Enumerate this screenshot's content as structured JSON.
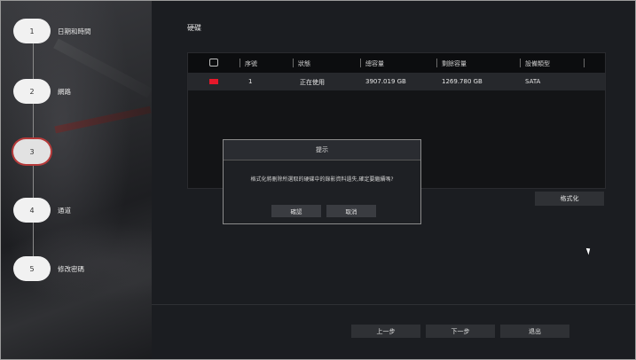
{
  "sidebar": {
    "steps": [
      {
        "num": "1",
        "label": "日期和時間"
      },
      {
        "num": "2",
        "label": "網路"
      },
      {
        "num": "3",
        "label": ""
      },
      {
        "num": "4",
        "label": "通道"
      },
      {
        "num": "5",
        "label": "修改密碼"
      }
    ]
  },
  "main": {
    "title": "硬碟",
    "table": {
      "headers": [
        "序號",
        "狀態",
        "總容量",
        "剩餘容量",
        "設備類型"
      ],
      "rows": [
        {
          "index": "1",
          "status": "正在使用",
          "total": "3907.019 GB",
          "free": "1269.780 GB",
          "type": "SATA"
        }
      ]
    },
    "format_label": "格式化"
  },
  "dialog": {
    "title": "提示",
    "message": "格式化將刪除所選取的硬碟中的錄影資料遺失,確定要繼續嗎?",
    "confirm_label": "確認",
    "cancel_label": "取消"
  },
  "nav": {
    "prev_label": "上一步",
    "next_label": "下一步",
    "exit_label": "退出"
  },
  "colors": {
    "accent": "#e5182a",
    "active_ring": "#b53a3a"
  }
}
